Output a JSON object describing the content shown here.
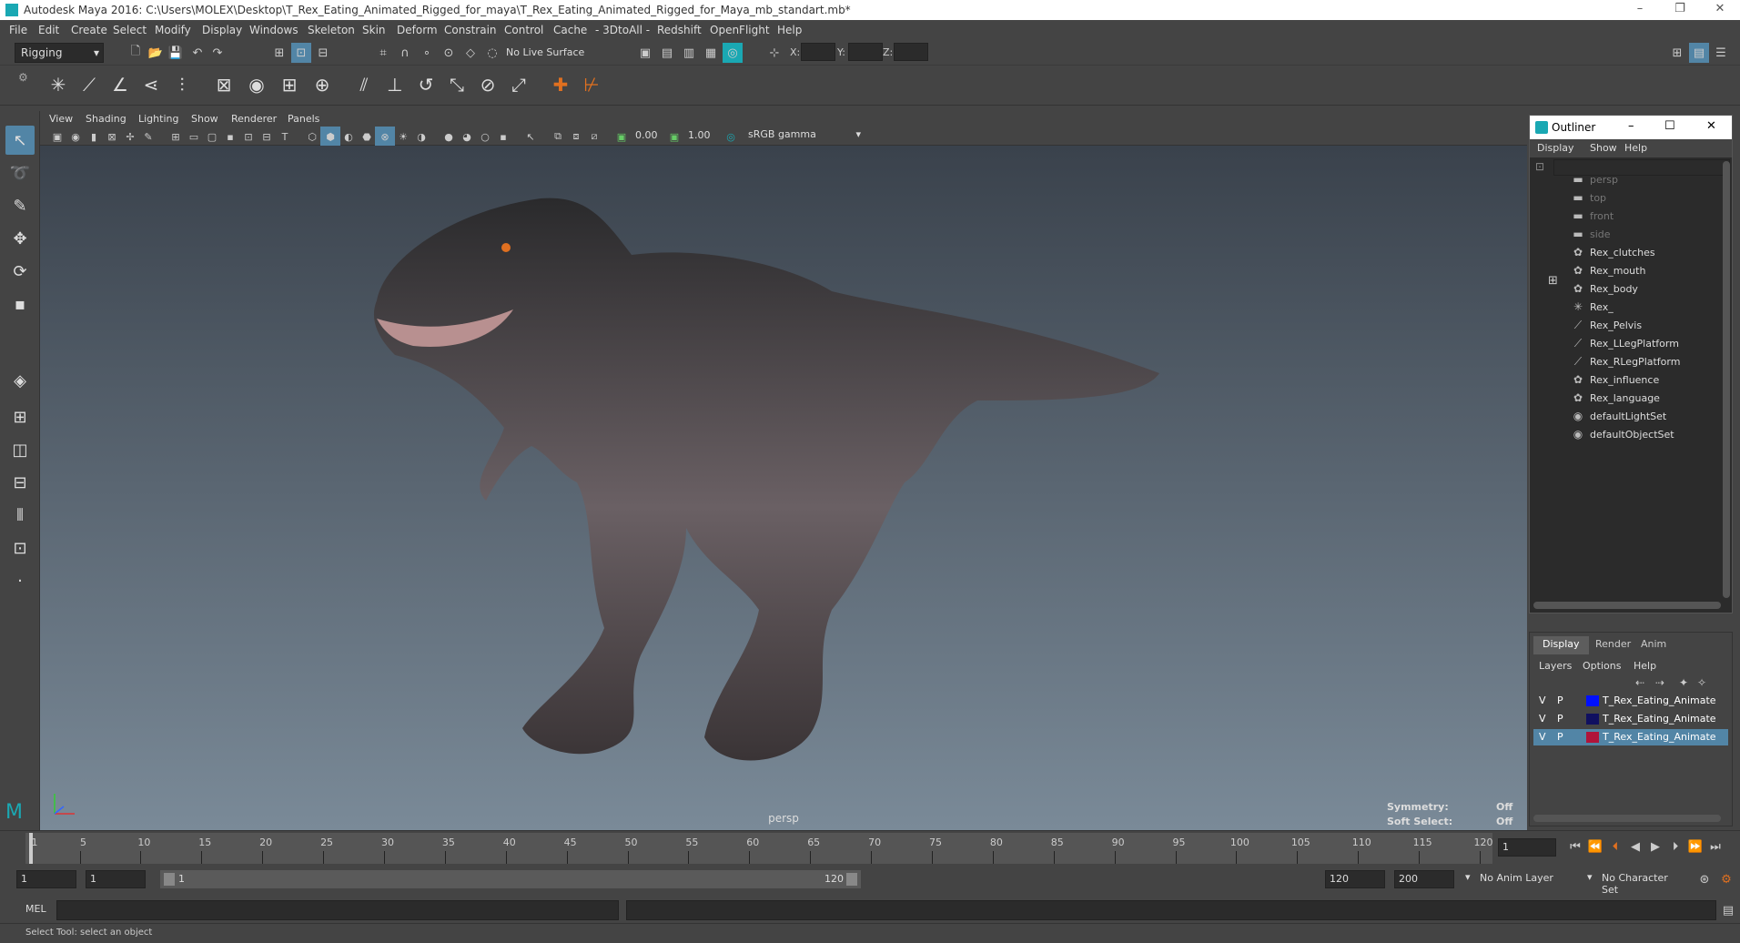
{
  "titlebar": {
    "title": "Autodesk Maya 2016: C:\\Users\\MOLEX\\Desktop\\T_Rex_Eating_Animated_Rigged_for_maya\\T_Rex_Eating_Animated_Rigged_for_Maya_mb_standart.mb*",
    "minimize": "–",
    "restore": "❐",
    "close": "✕"
  },
  "menus": [
    "File",
    "Edit",
    "Create",
    "Select",
    "Modify",
    "Display",
    "Windows",
    "Skeleton",
    "Skin",
    "Deform",
    "Constrain",
    "Control",
    "Cache",
    "- 3DtoAll -",
    "Redshift",
    "OpenFlight",
    "Help"
  ],
  "status": {
    "mode": "Rigging",
    "live_surface": "No Live Surface",
    "x_label": "X:",
    "y_label": "Y:",
    "z_label": "Z:"
  },
  "panel_menus": [
    "View",
    "Shading",
    "Lighting",
    "Show",
    "Renderer",
    "Panels"
  ],
  "panel_toolbar": {
    "near_value": "0.00",
    "far_value": "1.00",
    "color_space": "sRGB gamma"
  },
  "viewport": {
    "camera_label": "persp",
    "symmetry_label": "Symmetry:",
    "symmetry_value": "Off",
    "soft_select_label": "Soft Select:",
    "soft_select_value": "Off"
  },
  "outliner": {
    "title": "Outliner",
    "menus": [
      "Display",
      "Show",
      "Help"
    ],
    "items": [
      {
        "label": "persp",
        "icon": "camera-icon",
        "dim": true
      },
      {
        "label": "top",
        "icon": "camera-icon",
        "dim": true
      },
      {
        "label": "front",
        "icon": "camera-icon",
        "dim": true
      },
      {
        "label": "side",
        "icon": "camera-icon",
        "dim": true
      },
      {
        "label": "Rex_clutches",
        "icon": "mesh-icon",
        "dim": false
      },
      {
        "label": "Rex_mouth",
        "icon": "mesh-icon",
        "dim": false
      },
      {
        "label": "Rex_body",
        "icon": "mesh-icon",
        "dim": false
      },
      {
        "label": "Rex_",
        "icon": "locator-icon",
        "dim": false
      },
      {
        "label": "Rex_Pelvis",
        "icon": "joint-icon",
        "dim": false
      },
      {
        "label": "Rex_LLegPlatform",
        "icon": "joint-icon",
        "dim": false
      },
      {
        "label": "Rex_RLegPlatform",
        "icon": "joint-icon",
        "dim": false
      },
      {
        "label": "Rex_influence",
        "icon": "mesh-icon",
        "dim": false
      },
      {
        "label": "Rex_language",
        "icon": "mesh-icon",
        "dim": false
      },
      {
        "label": "defaultLightSet",
        "icon": "set-icon",
        "dim": false
      },
      {
        "label": "defaultObjectSet",
        "icon": "set-icon",
        "dim": false
      }
    ]
  },
  "layers": {
    "tabs": [
      "Display",
      "Render",
      "Anim"
    ],
    "menus": [
      "Layers",
      "Options",
      "Help"
    ],
    "rows": [
      {
        "v": "V",
        "p": "P",
        "color": "#0010ff",
        "name": "T_Rex_Eating_Animate",
        "selected": false
      },
      {
        "v": "V",
        "p": "P",
        "color": "#101060",
        "name": "T_Rex_Eating_Animate",
        "selected": false
      },
      {
        "v": "V",
        "p": "P",
        "color": "#b0143a",
        "name": "T_Rex_Eating_Animate",
        "selected": true
      }
    ]
  },
  "timeline": {
    "ticks": [
      "1",
      "5",
      "10",
      "15",
      "20",
      "25",
      "30",
      "35",
      "40",
      "45",
      "50",
      "55",
      "60",
      "65",
      "70",
      "75",
      "80",
      "85",
      "90",
      "95",
      "100",
      "105",
      "110",
      "115",
      "120"
    ],
    "current_frame": "1"
  },
  "range": {
    "start": "1",
    "playback_start": "1",
    "slider_start": "1",
    "slider_end": "120",
    "playback_end": "120",
    "end": "200",
    "anim_layer": "No Anim Layer",
    "character_set": "No Character Set"
  },
  "cmd": {
    "label": "MEL"
  },
  "help_line": "Select Tool: select an object"
}
